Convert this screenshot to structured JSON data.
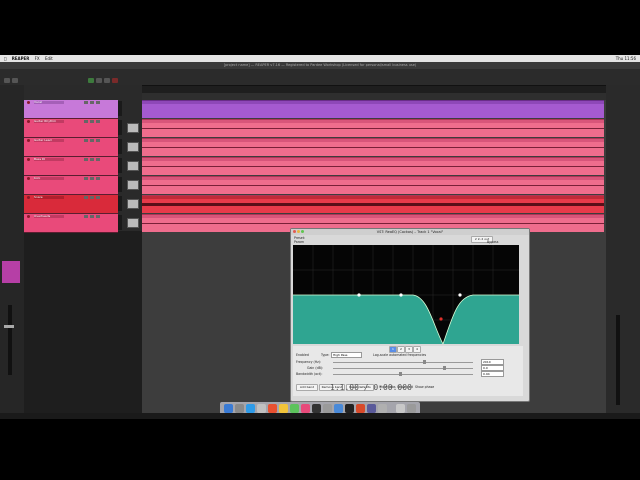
{
  "menubar": {
    "apple": "",
    "app_name": "REAPER",
    "menus": [
      "FX",
      "Edit"
    ],
    "clock": "Thu 11:56"
  },
  "window": {
    "title": "[project name] — REAPER v7.16 — Registered to Pardee Workshop (Licensed for personal/small business use)"
  },
  "tracks": [
    {
      "name": "Vocal",
      "color": "#c779d9"
    },
    {
      "name": "Guitar Rhythm",
      "color": "#e94a7a"
    },
    {
      "name": "Guitar Lead",
      "color": "#e94a7a"
    },
    {
      "name": "Bass DI",
      "color": "#e94a7a"
    },
    {
      "name": "Kick",
      "color": "#e94a7a"
    },
    {
      "name": "Snare",
      "color": "#d92a3a"
    },
    {
      "name": "Overheads",
      "color": "#e94a7a"
    }
  ],
  "eq": {
    "window_title": "VST: ReaEQ (Cockos) – Track 1 \"Vocal\"",
    "preset_label": "Preset:",
    "param_label": "Param",
    "io_label": "2 in 2 out",
    "bypass_label": "Bypass",
    "band_tabs": [
      "1",
      "2",
      "3",
      "4"
    ],
    "enabled_label": "Enabled",
    "type_label": "Type:",
    "type_value": "High Pass",
    "log_label": "Log-scale automated frequencies",
    "frequency_label": "Frequency (Hz):",
    "frequency_value": "2010",
    "gain_label": "Gain (dB):",
    "gain_value": "0.0",
    "bandwidth_label": "Bandwidth (oct):",
    "bandwidth_value": "0.94",
    "buttons": [
      "Add band",
      "Remove band",
      "Reset defaults",
      "Show tabs",
      "Show grid",
      "Show phase"
    ],
    "curve_color": "#2fa591"
  },
  "transport": {
    "time": "1.1.00 / 0:00.000"
  }
}
